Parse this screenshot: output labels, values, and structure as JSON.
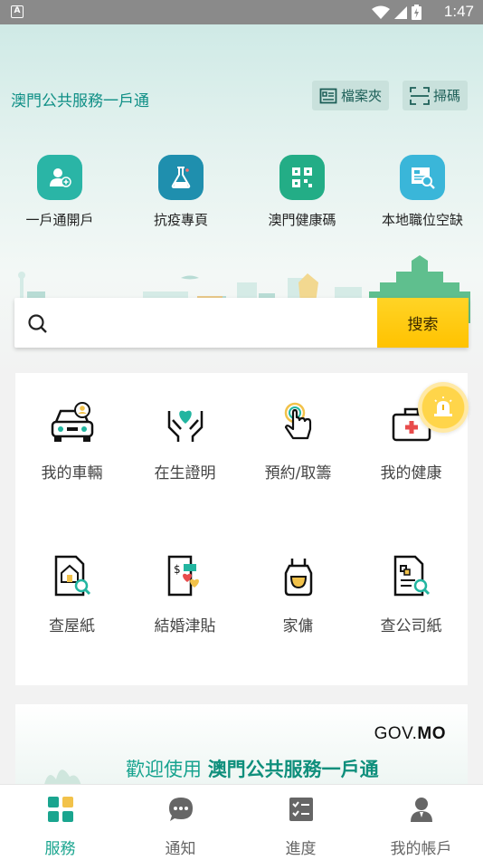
{
  "status_bar": {
    "time": "1:47",
    "notification_icon": "A"
  },
  "header": {
    "title": "澳門公共服務一戶通",
    "folder_label": "檔案夾",
    "scan_label": "掃碼"
  },
  "quick_links": [
    {
      "label": "一戶通開戶",
      "icon": "user-add-icon",
      "color": "#2ab5a6"
    },
    {
      "label": "抗疫專頁",
      "icon": "flask-icon",
      "color": "#1f8fae"
    },
    {
      "label": "澳門健康碼",
      "icon": "qr-code-icon",
      "color": "#23ad86"
    },
    {
      "label": "本地職位空缺",
      "icon": "job-search-icon",
      "color": "#3ab6d9"
    }
  ],
  "search": {
    "placeholder": "",
    "button_label": "搜索"
  },
  "services": [
    {
      "label": "我的車輛",
      "icon": "car-icon"
    },
    {
      "label": "在生證明",
      "icon": "hands-heart-icon"
    },
    {
      "label": "預約/取籌",
      "icon": "tap-hand-icon"
    },
    {
      "label": "我的健康",
      "icon": "medical-kit-icon"
    },
    {
      "label": "查屋紙",
      "icon": "house-doc-icon"
    },
    {
      "label": "結婚津貼",
      "icon": "marriage-doc-icon"
    },
    {
      "label": "家傭",
      "icon": "apron-icon"
    },
    {
      "label": "查公司紙",
      "icon": "company-doc-icon"
    }
  ],
  "banner": {
    "gov_prefix": "GOV.",
    "gov_suffix": "MO",
    "welcome_prefix": "歡迎使用",
    "welcome_name": "澳門公共服務一戶通"
  },
  "bottom_nav": [
    {
      "label": "服務",
      "icon": "grid-icon",
      "active": true
    },
    {
      "label": "通知",
      "icon": "chat-icon",
      "active": false
    },
    {
      "label": "進度",
      "icon": "checklist-icon",
      "active": false
    },
    {
      "label": "我的帳戶",
      "icon": "person-icon",
      "active": false
    }
  ],
  "colors": {
    "accent": "#1aa58f",
    "search_button": "#ffc200",
    "title": "#0f8f86"
  }
}
